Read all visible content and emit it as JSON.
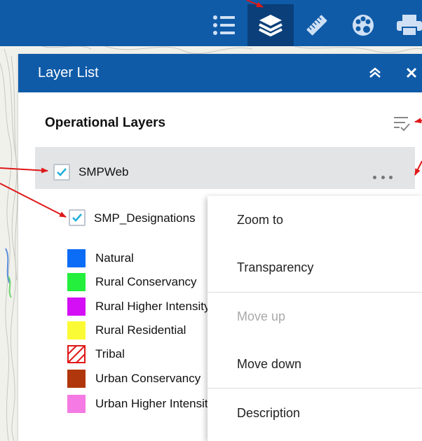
{
  "toolbar": {
    "tools": [
      {
        "icon": "legend-list-icon",
        "active": false
      },
      {
        "icon": "layers-icon",
        "active": true
      },
      {
        "icon": "measure-ruler-icon",
        "active": false
      },
      {
        "icon": "basemap-gallery-icon",
        "active": false
      },
      {
        "icon": "print-icon",
        "active": false
      }
    ],
    "colors": {
      "bar": "#0f5ba8",
      "active": "#0a3f7a"
    }
  },
  "panel": {
    "title": "Layer List",
    "collapse_icon": "double-chevron-up-icon",
    "close_icon": "close-icon",
    "section_title": "Operational Layers"
  },
  "layers": {
    "root": {
      "label": "SMPWeb",
      "checked": true
    },
    "child": {
      "label": "SMP_Designations",
      "checked": true
    }
  },
  "legend": [
    {
      "label": "Natural",
      "color": "#0b6cf5"
    },
    {
      "label": "Rural Conservancy",
      "color": "#23ef3c"
    },
    {
      "label": "Rural Higher Intensity",
      "color": "#d40ef5"
    },
    {
      "label": "Rural Residential",
      "color": "#fbfb35"
    },
    {
      "label": "Tribal",
      "color": "hatched-red"
    },
    {
      "label": "Urban Conservancy",
      "color": "#b0360b"
    },
    {
      "label": "Urban Higher Intensity",
      "color": "#f57ae3"
    }
  ],
  "menu": {
    "zoom_to": "Zoom to",
    "transparency": "Transparency",
    "move_up": "Move up",
    "move_down": "Move down",
    "description": "Description"
  },
  "annotation_color": "#e01818"
}
